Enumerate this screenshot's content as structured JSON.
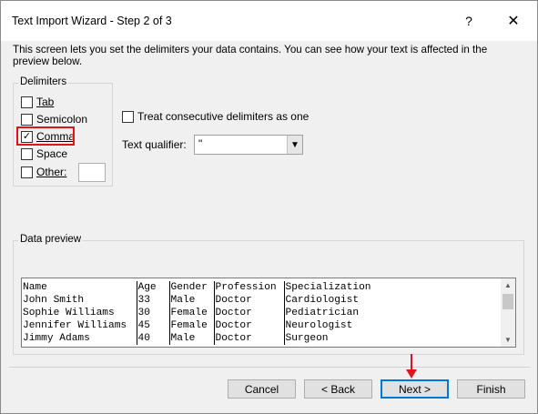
{
  "window": {
    "title": "Text Import Wizard - Step 2 of 3",
    "help_glyph": "?",
    "close_glyph": "✕"
  },
  "instruction": "This screen lets you set the delimiters your data contains.  You can see how your text is affected in the preview below.",
  "delimiters": {
    "group_label": "Delimiters",
    "items": [
      {
        "label": "Tab",
        "checked": false
      },
      {
        "label": "Semicolon",
        "checked": false
      },
      {
        "label": "Comma",
        "checked": true
      },
      {
        "label": "Space",
        "checked": false
      },
      {
        "label": "Other:",
        "checked": false
      }
    ],
    "other_value": ""
  },
  "consecutive": {
    "label": "Treat consecutive delimiters as one",
    "checked": false
  },
  "qualifier": {
    "label": "Text qualifier:",
    "value": "\""
  },
  "preview": {
    "group_label": "Data preview",
    "rows": [
      [
        "Name",
        "Age",
        "Gender",
        "Profession",
        "Specialization"
      ],
      [
        "John Smith",
        "33",
        "Male",
        "Doctor",
        "Cardiologist"
      ],
      [
        "Sophie Williams",
        "30",
        "Female",
        "Doctor",
        "Pediatrician"
      ],
      [
        "Jennifer Williams",
        "45",
        "Female",
        "Doctor",
        "Neurologist"
      ],
      [
        "Jimmy Adams",
        "40",
        "Male",
        "Doctor",
        "Surgeon"
      ]
    ]
  },
  "buttons": {
    "cancel": "Cancel",
    "back": "< Back",
    "next": "Next >",
    "finish": "Finish"
  },
  "colors": {
    "highlight_box": "#e0141a",
    "annotation_arrow": "#e0141a",
    "default_button_border": "#0078d7"
  }
}
